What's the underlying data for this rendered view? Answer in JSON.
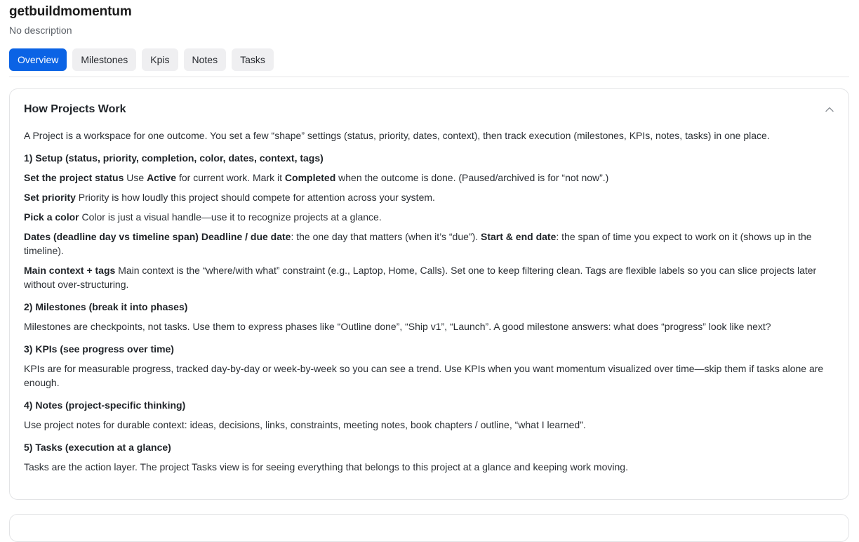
{
  "project": {
    "title": "getbuildmomentum",
    "description": "No description"
  },
  "tabs": [
    {
      "label": "Overview",
      "active": true
    },
    {
      "label": "Milestones",
      "active": false
    },
    {
      "label": "Kpis",
      "active": false
    },
    {
      "label": "Notes",
      "active": false
    },
    {
      "label": "Tasks",
      "active": false
    }
  ],
  "card": {
    "title": "How Projects Work",
    "collapse_icon": "chevron-up-icon",
    "intro": "A Project is a workspace for one outcome. You set a few “shape” settings (status, priority, dates, context), then track execution (milestones, KPIs, notes, tasks) in one place.",
    "sections": {
      "setup": {
        "heading": "1) Setup (status, priority, completion, color, dates, context, tags)",
        "status": {
          "label": "Set the project status",
          "t1": " Use ",
          "b1": "Active",
          "t2": " for current work. Mark it ",
          "b2": "Completed",
          "t3": " when the outcome is done. (Paused/archived is for “not now”.)"
        },
        "priority": {
          "label": "Set priority",
          "text": " Priority is how loudly this project should compete for attention across your system."
        },
        "color": {
          "label": "Pick a color",
          "text": " Color is just a visual handle—use it to recognize projects at a glance."
        },
        "dates": {
          "label": "Dates (deadline day vs timeline span)",
          "b1": " Deadline / due date",
          "t1": ": the one day that matters (when it’s “due”). ",
          "b2": "Start & end date",
          "t2": ": the span of time you expect to work on it (shows up in the timeline)."
        },
        "context": {
          "label": "Main context + tags",
          "text": " Main context is the “where/with what” constraint (e.g., Laptop, Home, Calls). Set one to keep filtering clean. Tags are flexible labels so you can slice projects later without over-structuring."
        }
      },
      "milestones": {
        "heading": "2) Milestones (break it into phases)",
        "text": "Milestones are checkpoints, not tasks. Use them to express phases like “Outline done”, “Ship v1”, “Launch”. A good milestone answers: what does “progress” look like next?"
      },
      "kpis": {
        "heading": "3) KPIs (see progress over time)",
        "text": "KPIs are for measurable progress, tracked day-by-day or week-by-week so you can see a trend. Use KPIs when you want momentum visualized over time—skip them if tasks alone are enough."
      },
      "notes": {
        "heading": "4) Notes (project-specific thinking)",
        "text": "Use project notes for durable context: ideas, decisions, links, constraints, meeting notes, book chapters / outline, “what I learned”."
      },
      "tasks": {
        "heading": "5) Tasks (execution at a glance)",
        "text": "Tasks are the action layer. The project Tasks view is for seeing everything that belongs to this project at a glance and keeping work moving."
      }
    }
  }
}
